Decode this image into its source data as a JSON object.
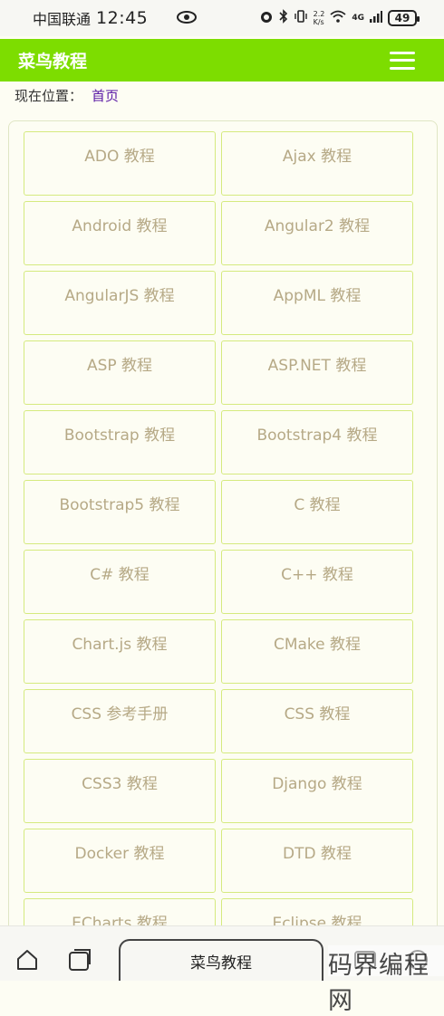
{
  "status_bar": {
    "carrier": "中国联通",
    "time": "12:45",
    "net_speed_value": "2.2",
    "net_speed_unit": "K/s",
    "signal": "4G",
    "battery": "49"
  },
  "header": {
    "title": "菜鸟教程"
  },
  "breadcrumb": {
    "label": "现在位置：",
    "home": "首页"
  },
  "tutorials": [
    "ADO 教程",
    "Ajax 教程",
    "Android 教程",
    "Angular2 教程",
    "AngularJS 教程",
    "AppML 教程",
    "ASP 教程",
    "ASP.NET 教程",
    "Bootstrap 教程",
    "Bootstrap4 教程",
    "Bootstrap5 教程",
    "C 教程",
    "C# 教程",
    "C++ 教程",
    "Chart.js 教程",
    "CMake 教程",
    "CSS 参考手册",
    "CSS 教程",
    "CSS3 教程",
    "Django 教程",
    "Docker 教程",
    "DTD 教程",
    "ECharts 教程",
    "Eclipse 教程"
  ],
  "bottom_bar": {
    "address": "菜鸟教程"
  },
  "watermark": "码界编程网",
  "colors": {
    "header_bg": "#7ddd00",
    "card_border": "#d5ea7f",
    "card_text": "#b6a986",
    "page_bg": "#fdfdf3",
    "link": "#5b1aa6"
  }
}
